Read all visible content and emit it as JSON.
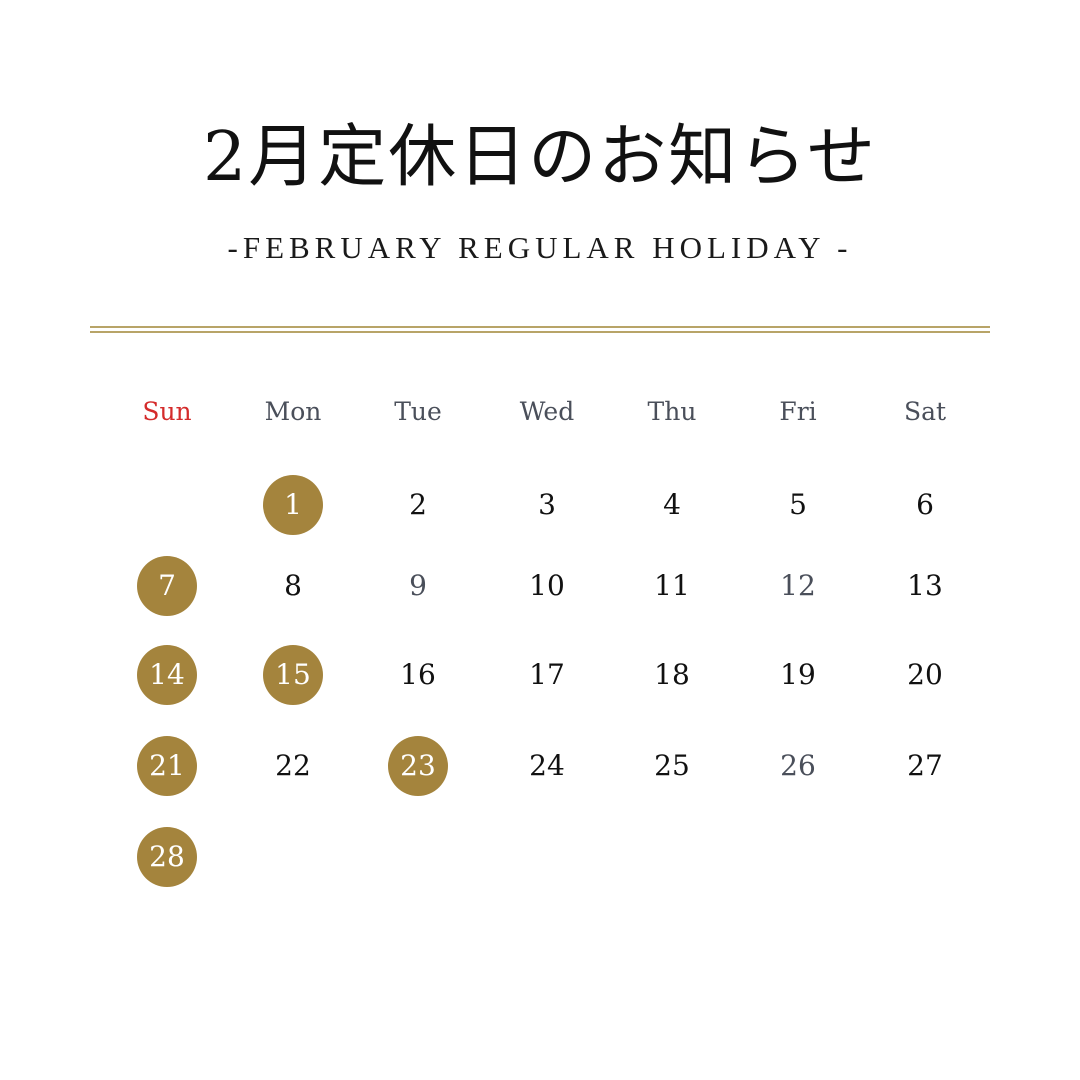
{
  "title": "2月定休日のお知らせ",
  "subtitle": "-FEBRUARY REGULAR HOLIDAY -",
  "colors": {
    "accent_gold": "#a4843d",
    "sunday_red": "#d42b2b",
    "weekday_gray": "#4a4f5a",
    "muted_gray": "#4a4f5a",
    "text_black": "#111111",
    "divider": "#b8a468"
  },
  "weekdays": [
    {
      "key": "sun",
      "label": "Sun",
      "color": "#d42b2b"
    },
    {
      "key": "mon",
      "label": "Mon",
      "color": "#4a4f5a"
    },
    {
      "key": "tue",
      "label": "Tue",
      "color": "#4a4f5a"
    },
    {
      "key": "wed",
      "label": "Wed",
      "color": "#4a4f5a"
    },
    {
      "key": "thu",
      "label": "Thu",
      "color": "#4a4f5a"
    },
    {
      "key": "fri",
      "label": "Fri",
      "color": "#4a4f5a"
    },
    {
      "key": "sat",
      "label": "Sat",
      "color": "#4a4f5a"
    }
  ],
  "days": [
    {
      "label": "1",
      "col": 1,
      "week": 0,
      "holiday": true,
      "muted": false
    },
    {
      "label": "2",
      "col": 2,
      "week": 0,
      "holiday": false,
      "muted": false
    },
    {
      "label": "3",
      "col": 3,
      "week": 0,
      "holiday": false,
      "muted": false
    },
    {
      "label": "4",
      "col": 4,
      "week": 0,
      "holiday": false,
      "muted": false
    },
    {
      "label": "5",
      "col": 5,
      "week": 0,
      "holiday": false,
      "muted": false
    },
    {
      "label": "6",
      "col": 6,
      "week": 0,
      "holiday": false,
      "muted": false
    },
    {
      "label": "7",
      "col": 0,
      "week": 1,
      "holiday": true,
      "muted": false
    },
    {
      "label": "8",
      "col": 1,
      "week": 1,
      "holiday": false,
      "muted": false
    },
    {
      "label": "9",
      "col": 2,
      "week": 1,
      "holiday": false,
      "muted": true
    },
    {
      "label": "10",
      "col": 3,
      "week": 1,
      "holiday": false,
      "muted": false
    },
    {
      "label": "11",
      "col": 4,
      "week": 1,
      "holiday": false,
      "muted": false
    },
    {
      "label": "12",
      "col": 5,
      "week": 1,
      "holiday": false,
      "muted": true
    },
    {
      "label": "13",
      "col": 6,
      "week": 1,
      "holiday": false,
      "muted": false
    },
    {
      "label": "14",
      "col": 0,
      "week": 2,
      "holiday": true,
      "muted": false
    },
    {
      "label": "15",
      "col": 1,
      "week": 2,
      "holiday": true,
      "muted": false
    },
    {
      "label": "16",
      "col": 2,
      "week": 2,
      "holiday": false,
      "muted": false
    },
    {
      "label": "17",
      "col": 3,
      "week": 2,
      "holiday": false,
      "muted": false
    },
    {
      "label": "18",
      "col": 4,
      "week": 2,
      "holiday": false,
      "muted": false
    },
    {
      "label": "19",
      "col": 5,
      "week": 2,
      "holiday": false,
      "muted": false
    },
    {
      "label": "20",
      "col": 6,
      "week": 2,
      "holiday": false,
      "muted": false
    },
    {
      "label": "21",
      "col": 0,
      "week": 3,
      "holiday": true,
      "muted": false
    },
    {
      "label": "22",
      "col": 1,
      "week": 3,
      "holiday": false,
      "muted": false
    },
    {
      "label": "23",
      "col": 2,
      "week": 3,
      "holiday": true,
      "muted": false
    },
    {
      "label": "24",
      "col": 3,
      "week": 3,
      "holiday": false,
      "muted": false
    },
    {
      "label": "25",
      "col": 4,
      "week": 3,
      "holiday": false,
      "muted": false
    },
    {
      "label": "26",
      "col": 5,
      "week": 3,
      "holiday": false,
      "muted": true
    },
    {
      "label": "27",
      "col": 6,
      "week": 3,
      "holiday": false,
      "muted": false
    },
    {
      "label": "28",
      "col": 0,
      "week": 4,
      "holiday": true,
      "muted": false
    }
  ]
}
